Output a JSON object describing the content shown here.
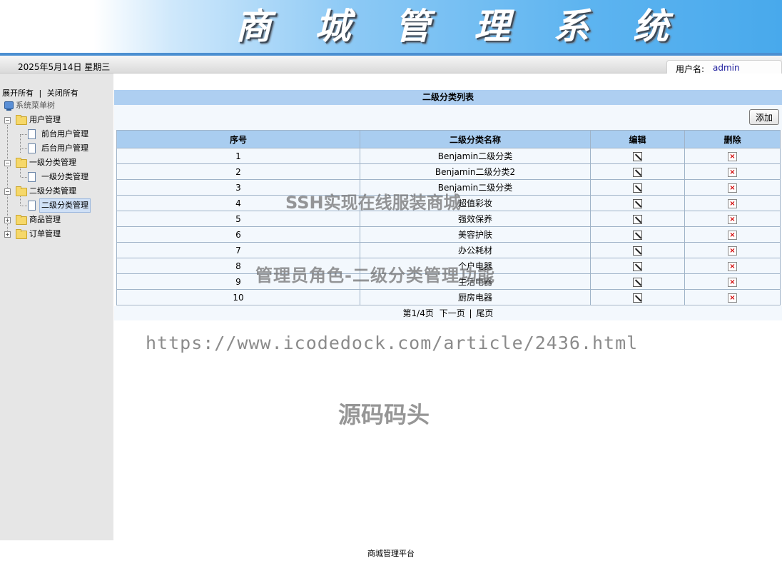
{
  "header": {
    "title": "商 城 管 理 系 统"
  },
  "statusbar": {
    "date": "2025年5月14日 星期三",
    "user_label": "用户名:",
    "user_name": "admin"
  },
  "sidebar": {
    "expand_all": "展开所有",
    "separator": "|",
    "collapse_all": "关闭所有",
    "root": "系统菜单树",
    "groups": [
      {
        "label": "用户管理",
        "expanded": true,
        "children": [
          "前台用户管理",
          "后台用户管理"
        ]
      },
      {
        "label": "一级分类管理",
        "expanded": true,
        "children": [
          "一级分类管理"
        ]
      },
      {
        "label": "二级分类管理",
        "expanded": true,
        "children": [
          "二级分类管理"
        ],
        "selected_child": "二级分类管理"
      },
      {
        "label": "商品管理",
        "expanded": false,
        "children": []
      },
      {
        "label": "订单管理",
        "expanded": false,
        "children": []
      }
    ]
  },
  "main": {
    "title": "二级分类列表",
    "add_label": "添加",
    "columns": [
      "序号",
      "二级分类名称",
      "编辑",
      "删除"
    ],
    "rows": [
      {
        "no": "1",
        "name": "Benjamin二级分类"
      },
      {
        "no": "2",
        "name": "Benjamin二级分类2"
      },
      {
        "no": "3",
        "name": "Benjamin二级分类"
      },
      {
        "no": "4",
        "name": "超值彩妆"
      },
      {
        "no": "5",
        "name": "强效保养"
      },
      {
        "no": "6",
        "name": "美容护肤"
      },
      {
        "no": "7",
        "name": "办公耗材"
      },
      {
        "no": "8",
        "name": "个户电器"
      },
      {
        "no": "9",
        "name": "生活电器"
      },
      {
        "no": "10",
        "name": "厨房电器"
      }
    ],
    "pager": {
      "page_info": "第1/4页",
      "next": "下一页",
      "separator": "|",
      "last": "尾页"
    }
  },
  "watermarks": {
    "line1": "SSH实现在线服装商城",
    "line2": "管理员角色-二级分类管理功能",
    "line3": "https://www.icodedock.com/article/2436.html",
    "line4": "源码码头"
  },
  "footer": {
    "text": "商城管理平台"
  },
  "icons": {
    "edit": "edit-pencil-icon",
    "delete": "delete-x-icon",
    "folder": "folder-icon",
    "page": "page-icon",
    "root": "computer-icon"
  }
}
